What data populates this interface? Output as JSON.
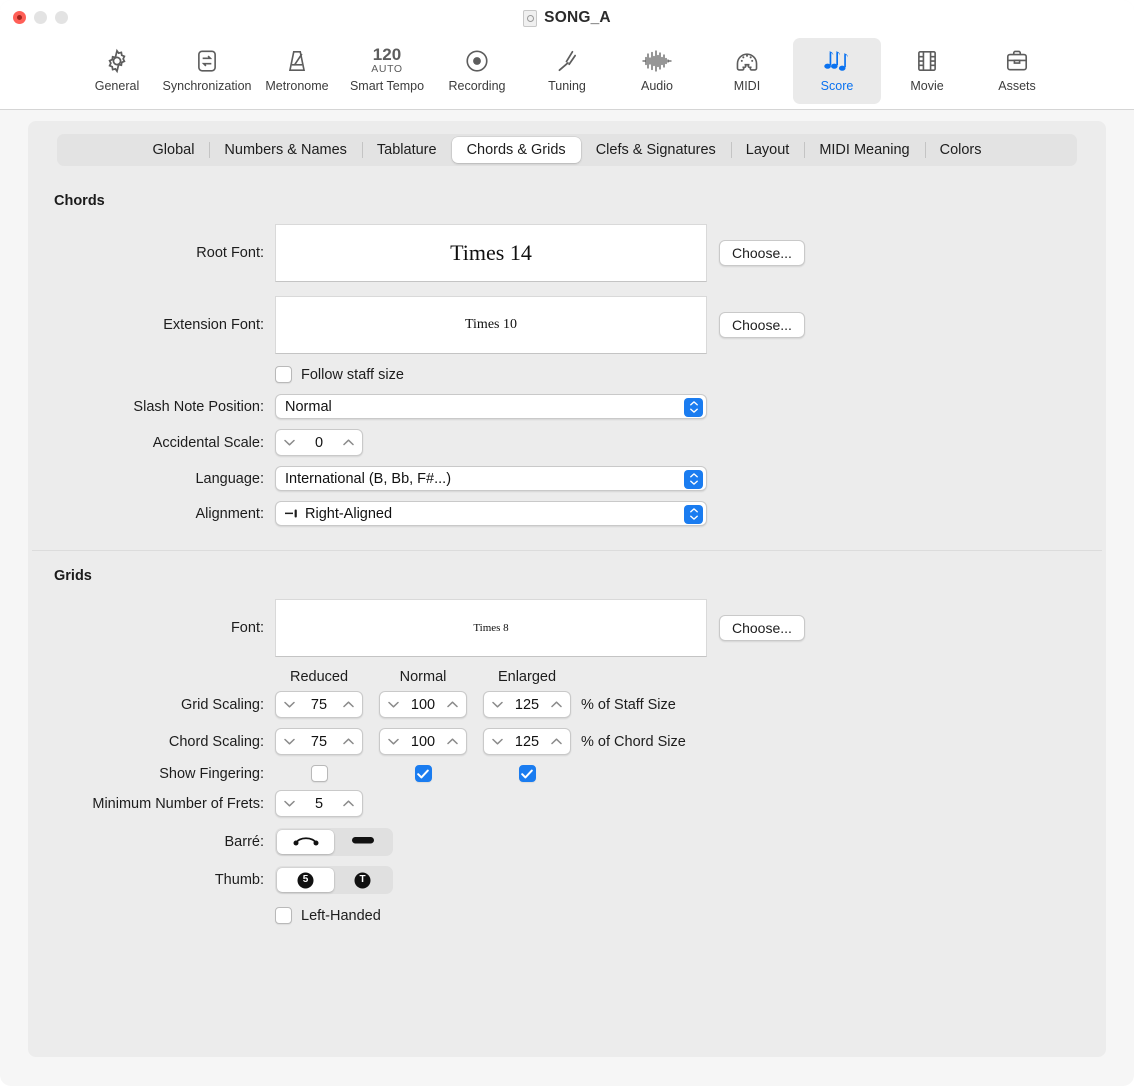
{
  "window": {
    "title": "SONG_A",
    "doc_icon": "document-icon",
    "traffic_lights": [
      "close",
      "minimize",
      "zoom"
    ]
  },
  "toolbar": {
    "selected": "Score",
    "accent_color": "#0a72f0",
    "items": [
      {
        "label": "General",
        "icon": "gear-icon"
      },
      {
        "label": "Synchronization",
        "icon": "sync-arrows-icon"
      },
      {
        "label": "Metronome",
        "icon": "metronome-icon"
      },
      {
        "label": "Smart Tempo",
        "icon": "tempo-120-auto-icon",
        "tempo": "120",
        "mode": "AUTO"
      },
      {
        "label": "Recording",
        "icon": "record-circle-icon"
      },
      {
        "label": "Tuning",
        "icon": "tuning-fork-icon"
      },
      {
        "label": "Audio",
        "icon": "waveform-icon"
      },
      {
        "label": "MIDI",
        "icon": "midi-connector-icon"
      },
      {
        "label": "Score",
        "icon": "music-notes-icon"
      },
      {
        "label": "Movie",
        "icon": "film-strip-icon"
      },
      {
        "label": "Assets",
        "icon": "briefcase-icon"
      }
    ]
  },
  "tabs": {
    "active": "Chords & Grids",
    "items": [
      "Global",
      "Numbers & Names",
      "Tablature",
      "Chords & Grids",
      "Clefs & Signatures",
      "Layout",
      "MIDI Meaning",
      "Colors"
    ]
  },
  "chords": {
    "heading": "Chords",
    "root_font": {
      "label": "Root Font:",
      "preview": "Times 14",
      "preview_size_px": 22,
      "button": "Choose..."
    },
    "extension_font": {
      "label": "Extension Font:",
      "preview": "Times 10",
      "preview_size_px": 14,
      "button": "Choose..."
    },
    "follow_staff_size": {
      "label": "Follow staff size",
      "checked": false
    },
    "slash_note_position": {
      "label": "Slash Note Position:",
      "value": "Normal"
    },
    "accidental_scale": {
      "label": "Accidental Scale:",
      "value": "0"
    },
    "language": {
      "label": "Language:",
      "value": "International (B, Bb, F#...)"
    },
    "alignment": {
      "label": "Alignment:",
      "value": "Right-Aligned",
      "icon": "right-align-icon"
    }
  },
  "grids": {
    "heading": "Grids",
    "font": {
      "label": "Font:",
      "preview": "Times 8",
      "preview_size_px": 11,
      "button": "Choose..."
    },
    "columns": [
      "Reduced",
      "Normal",
      "Enlarged"
    ],
    "grid_scaling": {
      "label": "Grid Scaling:",
      "values": [
        "75",
        "100",
        "125"
      ],
      "units": "% of Staff Size"
    },
    "chord_scaling": {
      "label": "Chord Scaling:",
      "values": [
        "75",
        "100",
        "125"
      ],
      "units": "% of Chord Size"
    },
    "show_fingering": {
      "label": "Show Fingering:",
      "checked": [
        false,
        true,
        true
      ]
    },
    "minimum_frets": {
      "label": "Minimum Number of Frets:",
      "value": "5"
    },
    "barre": {
      "label": "Barré:",
      "selected_index": 0,
      "options": [
        "barre-arc-icon",
        "barre-bar-icon"
      ]
    },
    "thumb": {
      "label": "Thumb:",
      "selected_index": 0,
      "options": [
        "thumb-5-icon",
        "thumb-t-icon"
      ],
      "option_text": [
        "5",
        "T"
      ]
    },
    "left_handed": {
      "label": "Left-Handed",
      "checked": false
    }
  }
}
